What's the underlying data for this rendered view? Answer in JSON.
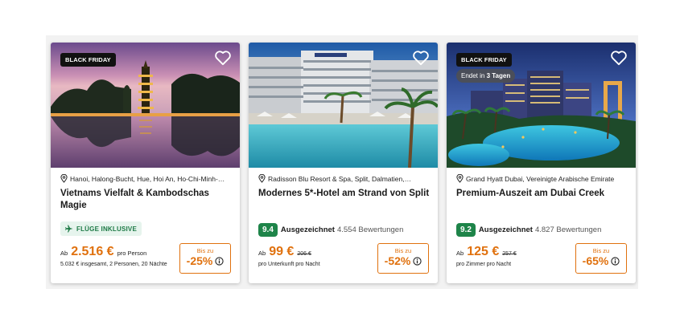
{
  "colors": {
    "accent": "#e0710e",
    "rating_green": "#1e8449",
    "flights_bg": "#e6f4ed",
    "flights_text": "#1e7a46"
  },
  "cards": [
    {
      "badge": "BLACK FRIDAY",
      "location": "Hanoi, Halong-Bucht, Hue, Hoi An, Ho-Chi-Minh-…",
      "title": "Vietnams Vielfalt & Kambodschas Magie",
      "flights_label": "FLÜGE INKLUSIVE",
      "price_prefix": "Ab",
      "price": "2.516 €",
      "price_unit": "pro Person",
      "price_sub": "5.032 € insgesamt, 2 Personen, 20 Nächte",
      "discount_prefix": "Bis zu",
      "discount": "-25%",
      "icons": [
        "heart-icon",
        "location-pin-icon",
        "plane-icon",
        "info-icon"
      ]
    },
    {
      "location": "Radisson Blu Resort & Spa, Split, Dalmatien,…",
      "title": "Modernes 5*-Hotel am Strand von Split",
      "rating_score": "9.4",
      "rating_label": "Ausgezeichnet",
      "rating_count": "4.554 Bewertungen",
      "price_prefix": "Ab",
      "price": "99 €",
      "price_old": "206 €",
      "price_sub": "pro Unterkunft pro Nacht",
      "discount_prefix": "Bis zu",
      "discount": "-52%",
      "icons": [
        "heart-icon",
        "location-pin-icon",
        "info-icon"
      ]
    },
    {
      "badge": "BLACK FRIDAY",
      "ends_prefix": "Endet in",
      "ends_value": "3 Tagen",
      "location": "Grand Hyatt Dubai, Vereinigte Arabische Emirate",
      "title": "Premium-Auszeit am Dubai Creek",
      "rating_score": "9.2",
      "rating_label": "Ausgezeichnet",
      "rating_count": "4.827 Bewertungen",
      "price_prefix": "Ab",
      "price": "125 €",
      "price_old": "257 €",
      "price_sub": "pro Zimmer pro Nacht",
      "discount_prefix": "Bis zu",
      "discount": "-65%",
      "icons": [
        "heart-icon",
        "location-pin-icon",
        "info-icon"
      ]
    }
  ]
}
